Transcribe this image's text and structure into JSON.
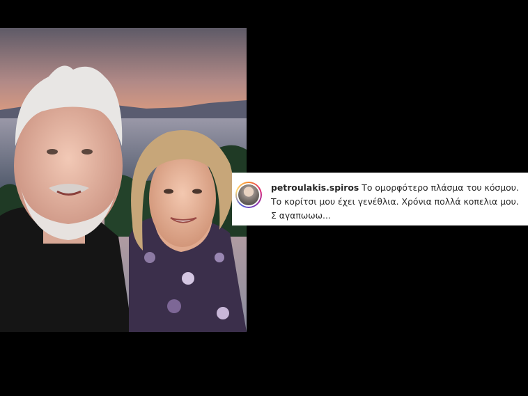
{
  "post": {
    "username": "petroulakis.spiros",
    "caption": "Το ομορφότερο πλάσμα του κόσμου. Το κορίτσι μου έχει γενέθλια. Χρόνια πολλά κοπελια μου. Σ αγαπωωω..."
  },
  "colors": {
    "background": "#000000",
    "card": "#ffffff",
    "text": "#262626"
  },
  "icons": {
    "avatar": "profile-avatar"
  }
}
